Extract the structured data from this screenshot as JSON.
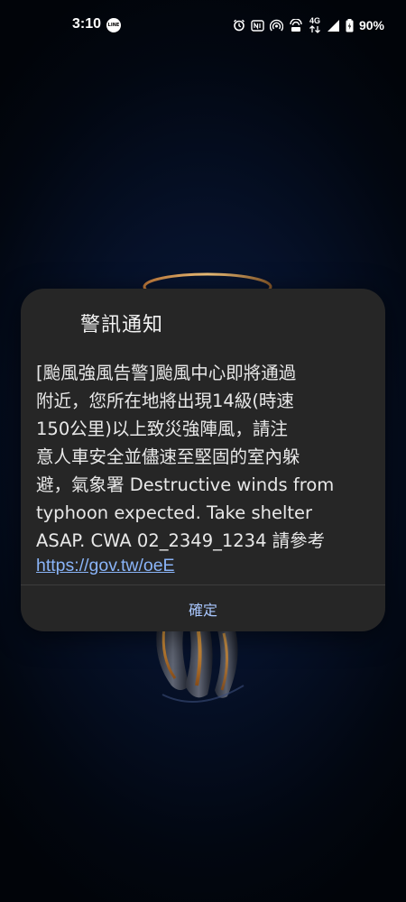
{
  "status_bar": {
    "time": "3:10",
    "line_icon_label": "LINE",
    "network_label": "4G",
    "battery_percent": "90%",
    "icons": [
      "line-icon",
      "alarm-icon",
      "nfc-icon",
      "hotspot-icon",
      "volte-icon",
      "data-arrows-icon",
      "signal-icon",
      "battery-icon"
    ]
  },
  "dialog": {
    "title": "警訊通知",
    "message": "[颱風強風告警]颱風中心即將通過\n附近，您所在地將出現14級(時速\n150公里)以上致災強陣風，請注\n意人車安全並儘速至堅固的室內躲\n避，氣象署 Destructive winds from\ntyphoon expected. Take shelter\nASAP. CWA 02_2349_1234 請參考",
    "link": "https://gov.tw/oeE",
    "confirm_label": "確定"
  },
  "colors": {
    "dialog_bg": "#262626",
    "link": "#8ab4f8",
    "button_text": "#a9c7ff"
  }
}
